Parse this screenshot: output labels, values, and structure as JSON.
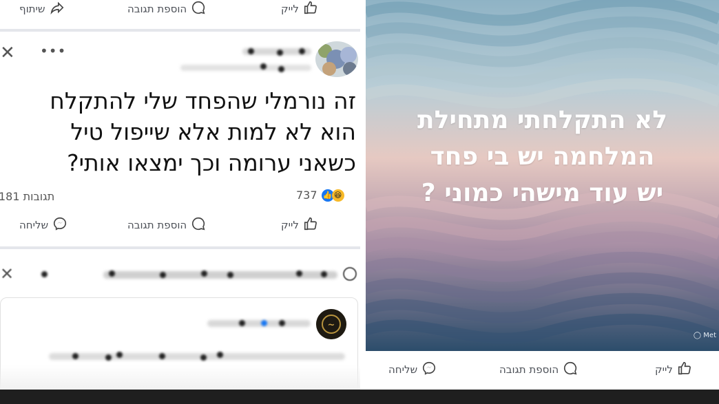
{
  "top_actions": {
    "like": "לייק",
    "comment": "הוספת תגובה",
    "share": "שיתוף"
  },
  "post": {
    "lines": [
      "זה נורמלי שהפחד שלי להתקלח",
      "הוא לא למות אלא שייפול טיל",
      "כשאני ערומה וכך ימצאו אותי?"
    ],
    "reaction_count": "737",
    "comments_count": "181 תגובות"
  },
  "post_actions": {
    "like": "לייק",
    "comment": "הוספת תגובה",
    "send": "שליחה"
  },
  "background_post": {
    "lines": [
      "לא התקלחתי מתחילת",
      "המלחמה יש בי פחד",
      "יש עוד מישהי כמוני ?"
    ],
    "watermark": "Met"
  },
  "right_actions": {
    "like": "לייק",
    "comment": "הוספת תגובה",
    "send": "שליחה"
  },
  "colors": {
    "accent": "#1877f2",
    "text": "#1c1e21",
    "muted": "#4b4f56",
    "separator": "#e4e6eb"
  }
}
